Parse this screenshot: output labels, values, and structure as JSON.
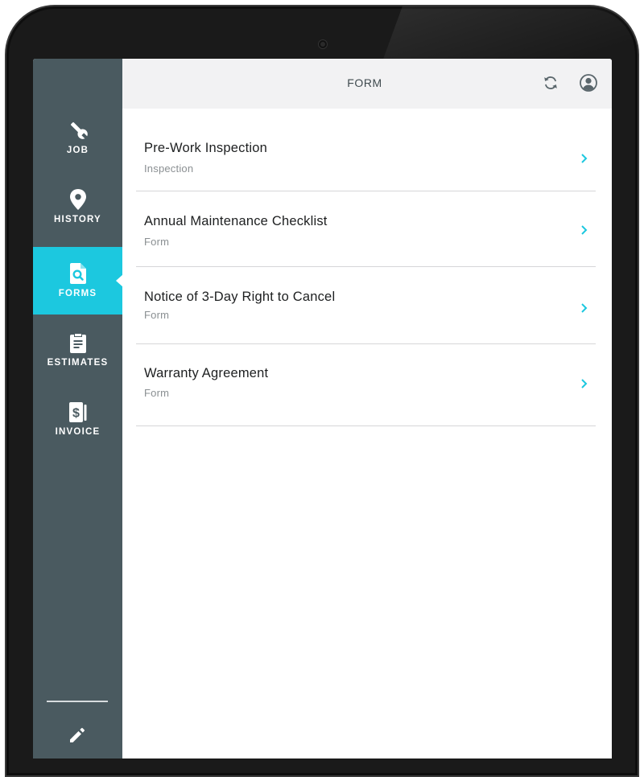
{
  "header": {
    "title": "FORM",
    "sync_icon": "sync-icon",
    "profile_icon": "user-circle-icon"
  },
  "sidebar": {
    "items": [
      {
        "label": "JOB",
        "icon": "wrench-icon",
        "active": false
      },
      {
        "label": "HISTORY",
        "icon": "map-pin-icon",
        "active": false
      },
      {
        "label": "FORMS",
        "icon": "document-search-icon",
        "active": true
      },
      {
        "label": "ESTIMATES",
        "icon": "clipboard-icon",
        "active": false
      },
      {
        "label": "INVOICE",
        "icon": "dollar-receipt-icon",
        "active": false
      }
    ],
    "edit_icon": "pencil-icon"
  },
  "forms": [
    {
      "title": "Pre-Work Inspection",
      "type": "Inspection"
    },
    {
      "title": "Annual Maintenance Checklist",
      "type": "Form"
    },
    {
      "title": "Notice of 3-Day Right to Cancel",
      "type": "Form"
    },
    {
      "title": "Warranty Agreement",
      "type": "Form"
    }
  ],
  "colors": {
    "sidebar_bg": "#4a5a60",
    "accent": "#1cc8df",
    "header_bg": "#f2f2f3"
  }
}
